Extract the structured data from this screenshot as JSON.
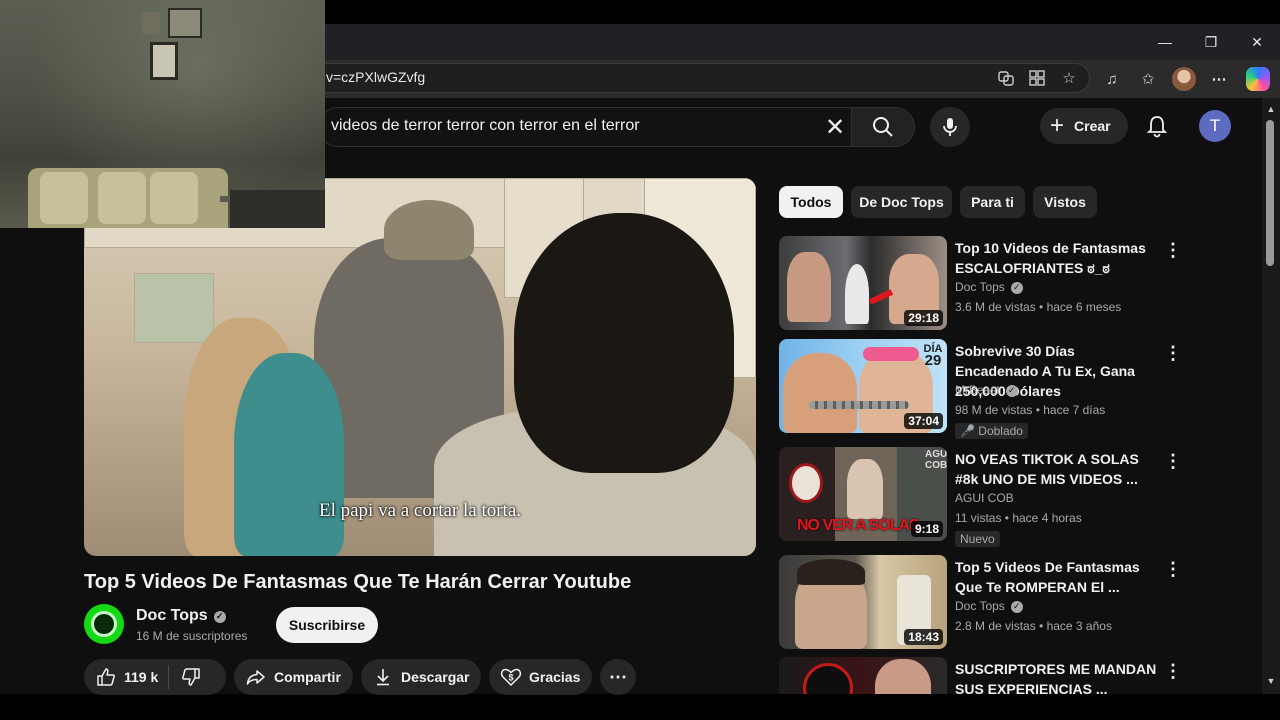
{
  "browser": {
    "url_fragment": "v=czPXlwGZvfg",
    "controls": {
      "minimize": "—",
      "restore": "❐",
      "close": "✕"
    }
  },
  "search": {
    "query": "videos de terror terror con terror en el terror"
  },
  "header": {
    "create_label": "Crear",
    "avatar_letter": "T"
  },
  "player": {
    "subtitle": "El papi va a cortar la torta."
  },
  "video": {
    "title": "Top 5 Videos De Fantasmas Que Te Harán Cerrar Youtube",
    "channel": "Doc Tops",
    "subscribers": "16 M de suscriptores",
    "subscribe_label": "Suscribirse",
    "likes": "119 k",
    "share_label": "Compartir",
    "download_label": "Descargar",
    "thanks_label": "Gracias"
  },
  "chips": [
    "Todos",
    "De Doc Tops",
    "Para ti",
    "Vistos"
  ],
  "recommendations": [
    {
      "title": "Top 10 Videos de Fantasmas ESCALOFRIANTES ಠ_ಠ",
      "channel": "Doc Tops",
      "verified": true,
      "meta": "3.6 M de vistas • hace 6 meses",
      "duration": "29:18",
      "badge": ""
    },
    {
      "title": "Sobrevive 30 Días Encadenado A Tu Ex, Gana 250,000 Dólares",
      "channel": "MrBeast",
      "verified": true,
      "meta": "98 M de vistas • hace 7 días",
      "duration": "37:04",
      "badge": "Doblado"
    },
    {
      "title": "NO VEAS TIKTOK A SOLAS #8k UNO DE MIS VIDEOS ...",
      "channel": "AGUI COB",
      "verified": false,
      "meta": "11 vistas • hace 4 horas",
      "duration": "9:18",
      "badge": "Nuevo"
    },
    {
      "title": "Top 5 Videos De Fantasmas Que Te ROMPERAN El ...",
      "channel": "Doc Tops",
      "verified": true,
      "meta": "2.8 M de vistas • hace 3 años",
      "duration": "18:43",
      "badge": ""
    },
    {
      "title": "SUSCRIPTORES ME MANDAN SUS EXPERIENCIAS ...",
      "channel": "",
      "verified": false,
      "meta": "",
      "duration": "",
      "badge": ""
    }
  ],
  "thumb_text": {
    "dia": "DÍA",
    "dia_num": "29",
    "agui": "AGUI",
    "cob": "COB",
    "no_ver": "NO VER A SOLAS"
  },
  "colors": {
    "background": "#0f0f0f",
    "accent_avatar": "#5c6bc0",
    "channel_green": "#16d916"
  }
}
